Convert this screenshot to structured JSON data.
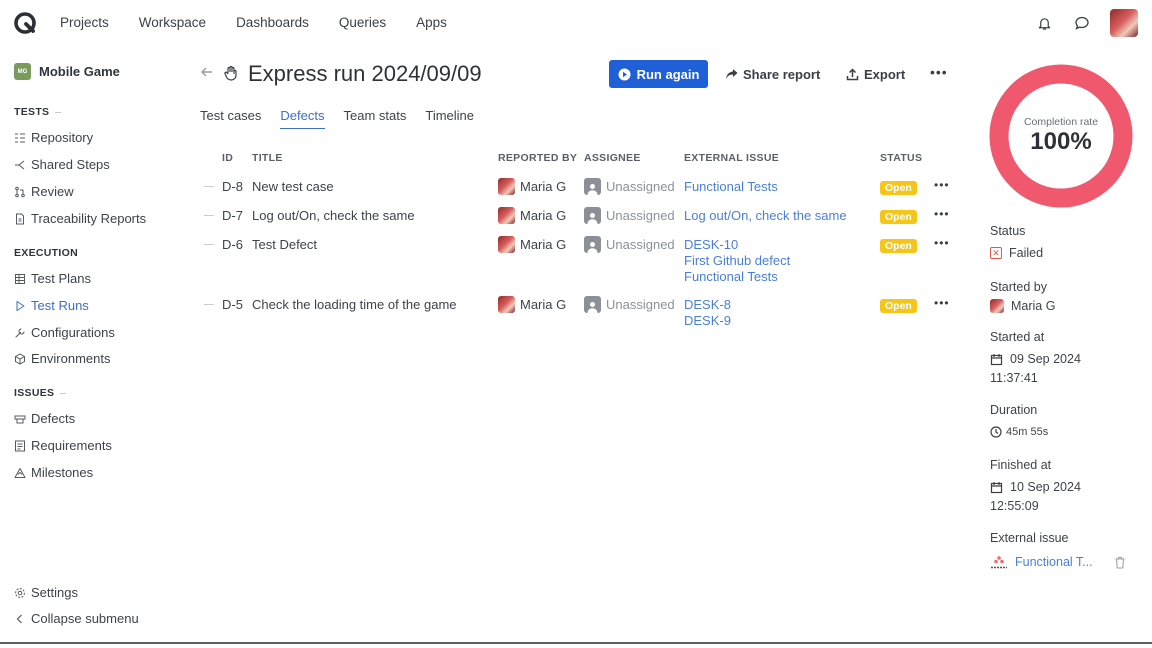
{
  "topbar": {
    "nav": [
      "Projects",
      "Workspace",
      "Dashboards",
      "Queries",
      "Apps"
    ]
  },
  "sidebar": {
    "project_name": "Mobile Game",
    "project_badge": "MG",
    "tests_title": "TESTS",
    "tests_items": [
      "Repository",
      "Shared Steps",
      "Review",
      "Traceability Reports"
    ],
    "execution_title": "EXECUTION",
    "execution_items": [
      "Test Plans",
      "Test Runs",
      "Configurations",
      "Environments"
    ],
    "issues_title": "ISSUES",
    "issues_items": [
      "Defects",
      "Requirements",
      "Milestones"
    ],
    "settings": "Settings",
    "collapse": "Collapse submenu"
  },
  "header": {
    "title": "Express run 2024/09/09",
    "run_again": "Run again",
    "share_report": "Share report",
    "export": "Export"
  },
  "tabs": [
    "Test cases",
    "Defects",
    "Team stats",
    "Timeline"
  ],
  "table": {
    "headers": [
      "ID",
      "TITLE",
      "REPORTED BY",
      "ASSIGNEE",
      "EXTERNAL ISSUE",
      "STATUS"
    ],
    "rows": [
      {
        "id": "D-8",
        "title": "New test case",
        "reporter": "Maria G",
        "assignee": "Unassigned",
        "external": [
          "Functional Tests"
        ],
        "status": "Open"
      },
      {
        "id": "D-7",
        "title": "Log out/On, check the same",
        "reporter": "Maria G",
        "assignee": "Unassigned",
        "external": [
          "Log out/On, check the same"
        ],
        "status": "Open"
      },
      {
        "id": "D-6",
        "title": "Test Defect",
        "reporter": "Maria G",
        "assignee": "Unassigned",
        "external": [
          "DESK-10",
          "First Github defect",
          "Functional Tests"
        ],
        "status": "Open"
      },
      {
        "id": "D-5",
        "title": "Check the loading time of the game",
        "reporter": "Maria G",
        "assignee": "Unassigned",
        "external": [
          "DESK-8",
          "DESK-9"
        ],
        "status": "Open"
      }
    ]
  },
  "summary": {
    "completion_label": "Completion rate",
    "completion_value": "100%",
    "completion_fraction": 1.0,
    "status_label": "Status",
    "status_value": "Failed",
    "started_by_label": "Started by",
    "started_by_value": "Maria G",
    "started_at_label": "Started at",
    "started_at_date": "09 Sep 2024",
    "started_at_time": "11:37:41",
    "duration_label": "Duration",
    "duration_value": "45m 55s",
    "finished_at_label": "Finished at",
    "finished_at_date": "10 Sep 2024",
    "finished_at_time": "12:55:09",
    "external_issue_label": "External issue",
    "external_issue_value": "Functional T...",
    "external_issue_logo": "asana"
  },
  "colors": {
    "accent": "#1f5fd8",
    "link": "#4a7fd6",
    "ring": "#f0586e",
    "open_badge": "#f5c518",
    "failed": "#e2574c"
  }
}
